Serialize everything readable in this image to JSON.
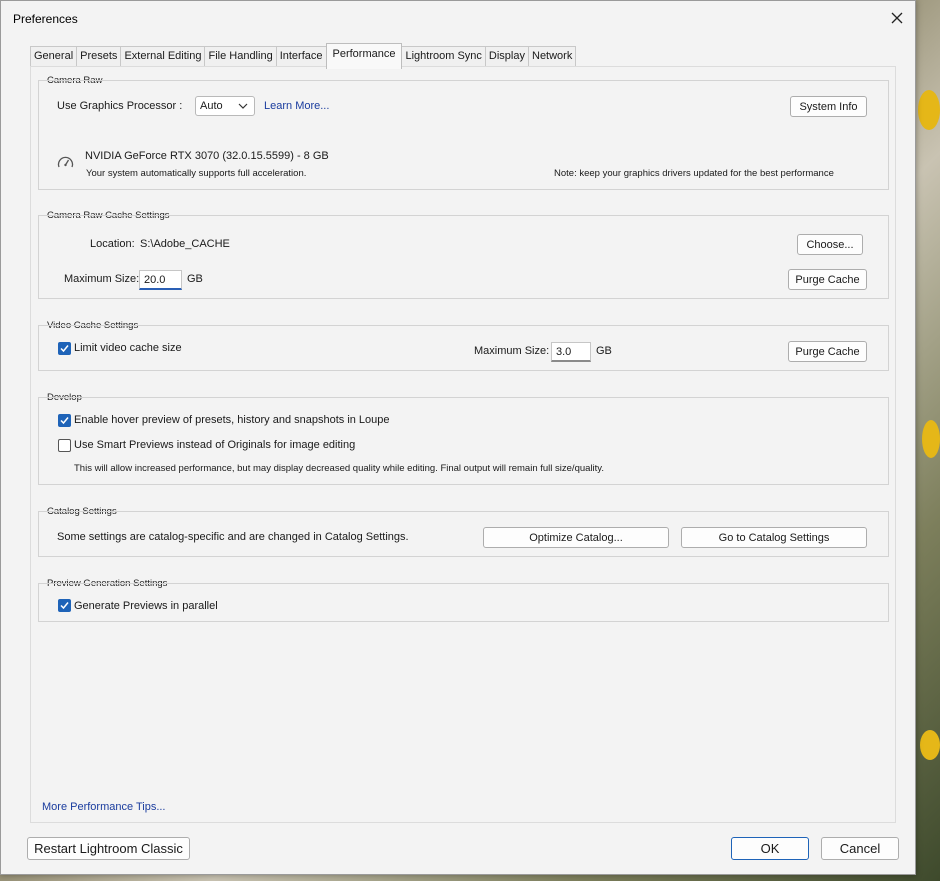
{
  "window": {
    "title": "Preferences"
  },
  "tabs": [
    {
      "label": "General"
    },
    {
      "label": "Presets"
    },
    {
      "label": "External Editing"
    },
    {
      "label": "File Handling"
    },
    {
      "label": "Interface"
    },
    {
      "label": "Performance"
    },
    {
      "label": "Lightroom Sync"
    },
    {
      "label": "Display"
    },
    {
      "label": "Network"
    }
  ],
  "active_tab": "Performance",
  "camera_raw": {
    "title": "Camera Raw",
    "gpu_label": "Use Graphics Processor :",
    "gpu_value": "Auto",
    "learn_more": "Learn More...",
    "system_info": "System Info",
    "gpu_name": "NVIDIA GeForce RTX 3070 (32.0.15.5599) - 8 GB",
    "gpu_status": "Your system automatically supports full acceleration.",
    "note": "Note: keep your graphics drivers updated for the best performance"
  },
  "cache": {
    "title": "Camera Raw Cache Settings",
    "location_label": "Location:",
    "location_value": "S:\\Adobe_CACHE",
    "choose": "Choose...",
    "max_label": "Maximum Size:",
    "max_value": "20.0",
    "unit": "GB",
    "purge": "Purge Cache"
  },
  "video_cache": {
    "title": "Video Cache Settings",
    "limit_label": "Limit video cache size",
    "limit_checked": true,
    "max_label": "Maximum Size:",
    "max_value": "3.0",
    "unit": "GB",
    "purge": "Purge Cache"
  },
  "develop": {
    "title": "Develop",
    "hover_label": "Enable hover preview of presets, history and snapshots in Loupe",
    "hover_checked": true,
    "smart_label": "Use Smart Previews instead of Originals for image editing",
    "smart_checked": false,
    "smart_note": "This will allow increased performance, but may display decreased quality while editing. Final output will remain full size/quality."
  },
  "catalog": {
    "title": "Catalog Settings",
    "text": "Some settings are catalog-specific and are changed in Catalog Settings.",
    "optimize": "Optimize Catalog...",
    "goto": "Go to Catalog Settings"
  },
  "preview": {
    "title": "Preview Generation Settings",
    "parallel_label": "Generate Previews in parallel",
    "parallel_checked": true
  },
  "footer": {
    "tips": "More Performance Tips...",
    "restart": "Restart Lightroom Classic",
    "ok": "OK",
    "cancel": "Cancel"
  },
  "colors": {
    "accent": "#1e63b8",
    "link": "#1a3c9e"
  }
}
